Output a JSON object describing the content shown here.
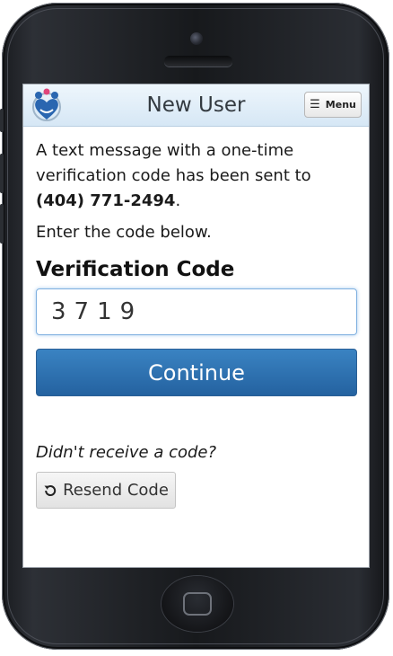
{
  "header": {
    "title": "New User",
    "menu_label": "Menu",
    "menu_icon": "hamburger-icon",
    "logo_icon": "family-heart-logo"
  },
  "message": {
    "prefix": "A text message with a one-time verification code has been sent to ",
    "phone": "(404) 771-2494",
    "suffix": "."
  },
  "instruction": "Enter the code below.",
  "verification": {
    "label": "Verification Code",
    "value": "3719",
    "placeholder": ""
  },
  "continue_label": "Continue",
  "resend": {
    "prompt": "Didn't receive a code?",
    "button_label": "Resend Code",
    "icon": "refresh-icon"
  },
  "colors": {
    "primary": "#2d70b0",
    "header_bg": "#dceaf6",
    "input_focus": "#7fb0e0"
  }
}
